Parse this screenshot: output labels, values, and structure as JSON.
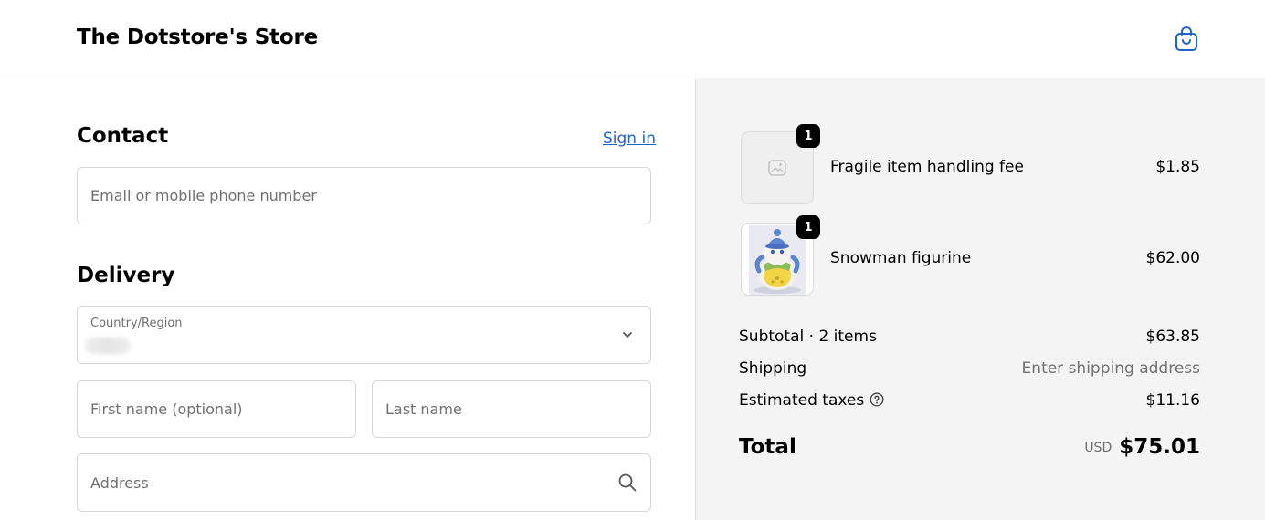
{
  "header": {
    "store_name": "The Dotstore's Store",
    "cart_icon": "shopping-bag-icon",
    "accent_color": "#1f64c8"
  },
  "contact": {
    "title": "Contact",
    "sign_in_label": "Sign in",
    "email_placeholder": "Email or mobile phone number"
  },
  "delivery": {
    "title": "Delivery",
    "country_label": "Country/Region",
    "first_name_placeholder": "First name (optional)",
    "last_name_placeholder": "Last name",
    "address_placeholder": "Address"
  },
  "order": {
    "items": [
      {
        "name": "Fragile item handling fee",
        "price": "$1.85",
        "quantity": "1",
        "image": "image-placeholder-icon"
      },
      {
        "name": "Snowman figurine",
        "price": "$62.00",
        "quantity": "1",
        "image": "snowman-figurine-photo"
      }
    ],
    "subtotal_label": "Subtotal · 2 items",
    "subtotal_value": "$63.85",
    "shipping_label": "Shipping",
    "shipping_value": "Enter shipping address",
    "taxes_label": "Estimated taxes",
    "taxes_value": "$11.16",
    "total_label": "Total",
    "currency": "USD",
    "total_value": "$75.01"
  }
}
